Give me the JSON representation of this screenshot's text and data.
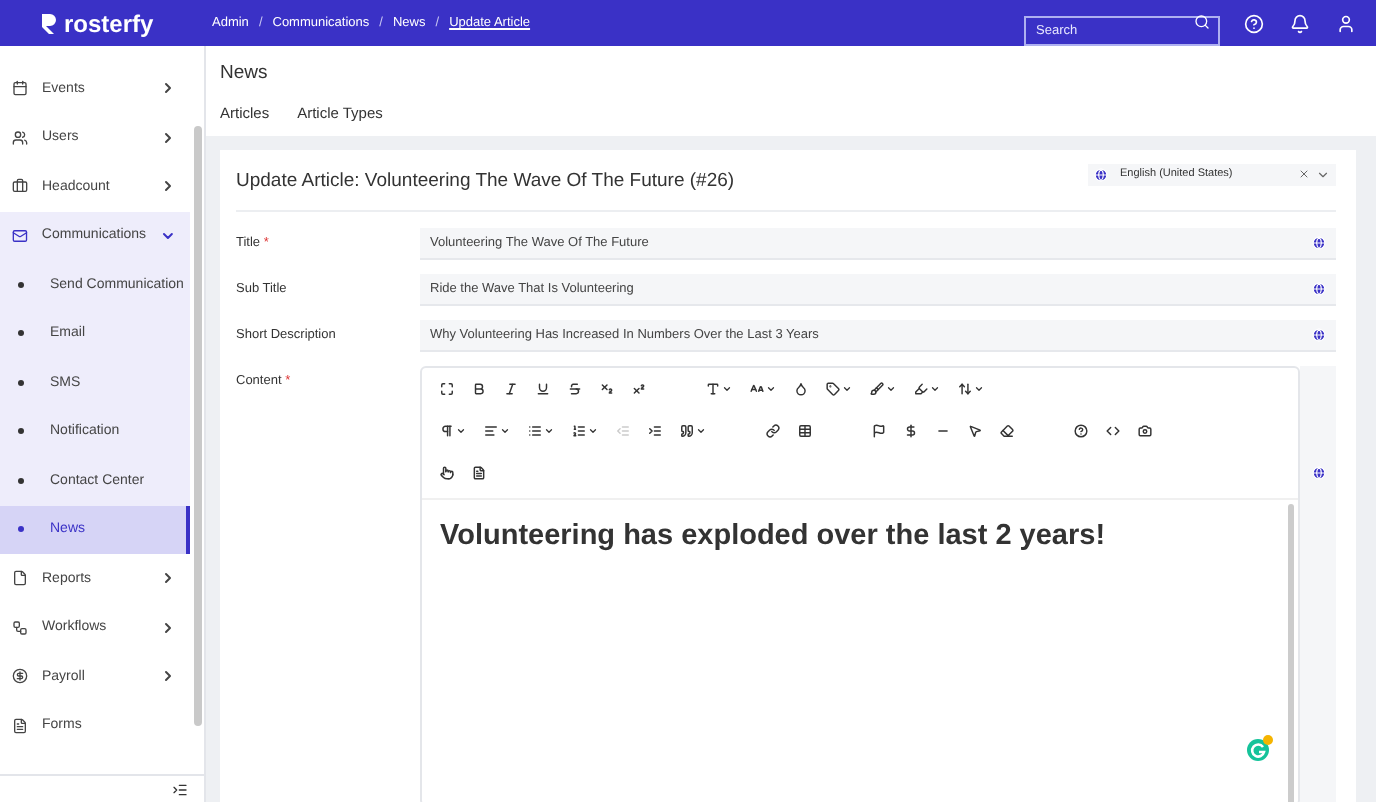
{
  "header": {
    "logo": "rosterfy",
    "separator": "/",
    "breadcrumbs": [
      {
        "label": "Admin",
        "current": false
      },
      {
        "label": "Communications",
        "current": false
      },
      {
        "label": "News",
        "current": false
      },
      {
        "label": "Update Article",
        "current": true
      }
    ],
    "search": {
      "placeholder": "Search"
    }
  },
  "sidebar": {
    "items": [
      {
        "label": "Events",
        "expanded": false,
        "selected": false
      },
      {
        "label": "Users",
        "expanded": false,
        "selected": false
      },
      {
        "label": "Headcount",
        "expanded": false,
        "selected": false
      },
      {
        "label": "Communications",
        "expanded": true,
        "selected": false,
        "children": [
          {
            "label": "Send Communication",
            "selected": false
          },
          {
            "label": "Email",
            "selected": false
          },
          {
            "label": "SMS",
            "selected": false
          },
          {
            "label": "Notification",
            "selected": false
          },
          {
            "label": "Contact Center",
            "selected": false
          },
          {
            "label": "News",
            "selected": true
          }
        ]
      },
      {
        "label": "Reports",
        "expanded": false,
        "selected": false
      },
      {
        "label": "Workflows",
        "expanded": false,
        "selected": false
      },
      {
        "label": "Payroll",
        "expanded": false,
        "selected": false
      },
      {
        "label": "Forms",
        "selected": false
      }
    ]
  },
  "page": {
    "title": "News",
    "tabs": [
      {
        "label": "Articles",
        "selected": false
      },
      {
        "label": "Article Types",
        "selected": false
      }
    ]
  },
  "form": {
    "title": "Update Article: Volunteering The Wave Of The Future (#26)",
    "language": "English (United States)",
    "required_mark": "*",
    "fields": [
      {
        "label": "Title",
        "required": true,
        "value": "Volunteering The Wave Of The Future"
      },
      {
        "label": "Sub Title",
        "required": false,
        "value": "Ride the Wave That Is Volunteering"
      },
      {
        "label": "Short Description",
        "required": false,
        "value": "Why Volunteering Has Increased In Numbers Over the Last 3 Years"
      }
    ],
    "content": {
      "label": "Content",
      "required": true,
      "heading": "Volunteering has exploded over the last 2 years!"
    }
  }
}
